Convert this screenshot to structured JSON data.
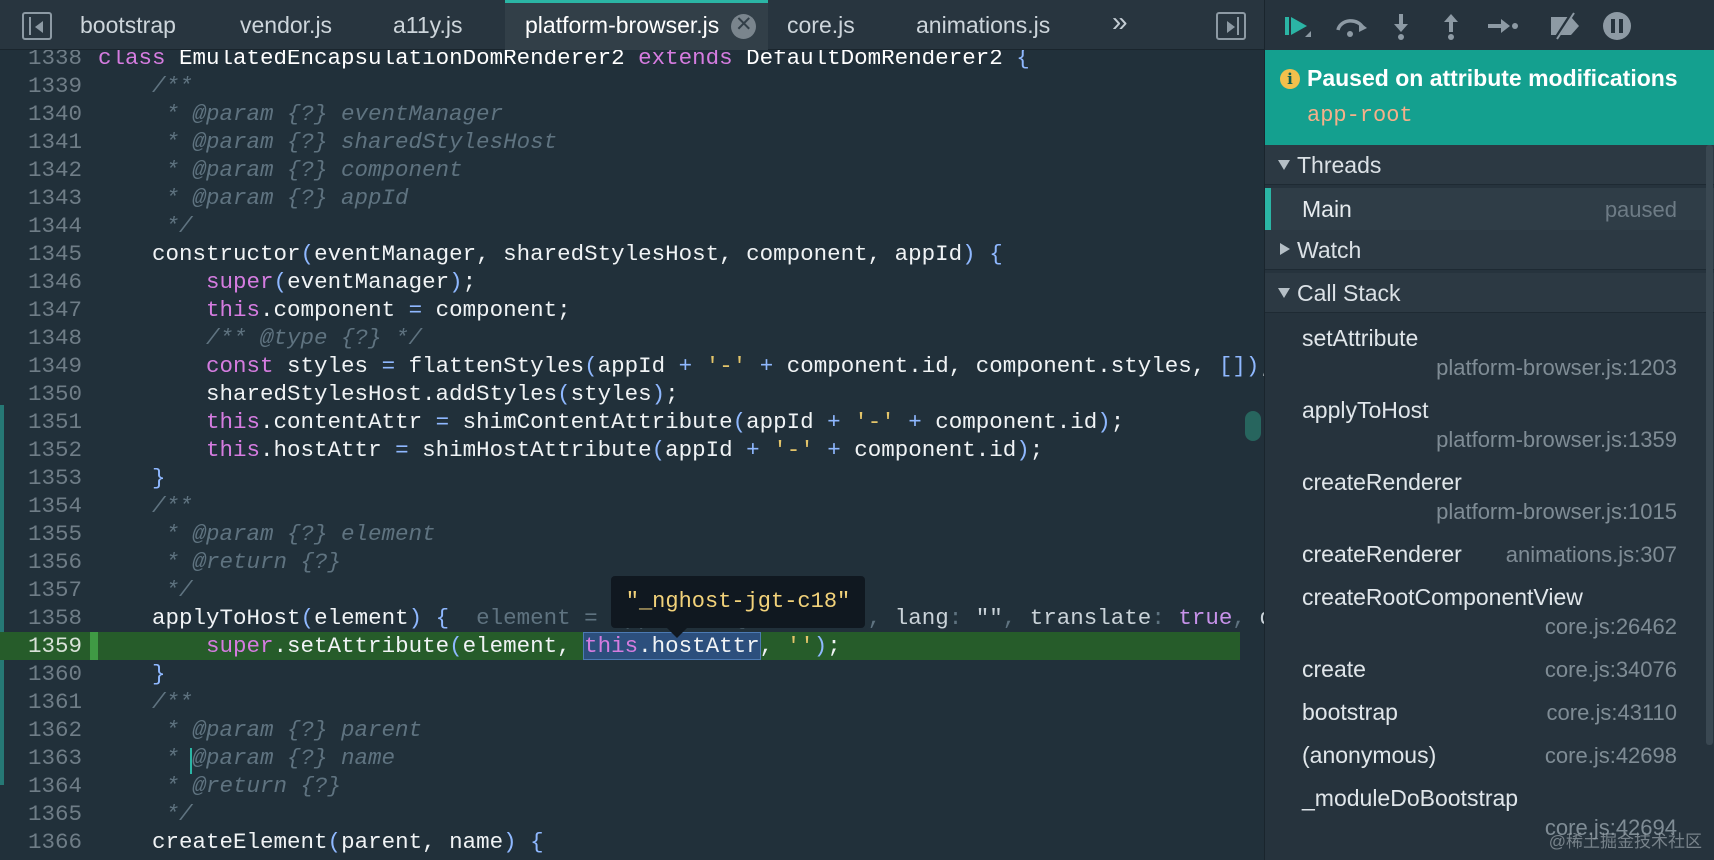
{
  "tabs": [
    {
      "label": "bootstrap"
    },
    {
      "label": "vendor.js"
    },
    {
      "label": "a11y.js"
    },
    {
      "label": "platform-browser.js",
      "active": true
    },
    {
      "label": "core.js"
    },
    {
      "label": "animations.js"
    }
  ],
  "tabs_more": "»",
  "tab_close": "✕",
  "editor": {
    "line_numbers": [
      "1338",
      "1339",
      "1340",
      "1341",
      "1342",
      "1343",
      "1344",
      "1345",
      "1346",
      "1347",
      "1348",
      "1349",
      "1350",
      "1351",
      "1352",
      "1353",
      "1354",
      "1355",
      "1356",
      "1357",
      "1358",
      "1359",
      "1360",
      "1361",
      "1362",
      "1363",
      "1364",
      "1365",
      "1366"
    ],
    "current_line": "1359",
    "tooltip": "\"_nghost-jgt-c18\""
  },
  "debugger": {
    "paused_title": "Paused on attribute modifications",
    "paused_target": "app-root",
    "info_icon": "i",
    "sections": {
      "threads": "Threads",
      "watch": "Watch",
      "call_stack": "Call Stack"
    },
    "thread": {
      "name": "Main",
      "state": "paused"
    },
    "call_stack": [
      {
        "fn": "setAttribute",
        "loc": "platform-browser.js:1203"
      },
      {
        "fn": "applyToHost",
        "loc": "platform-browser.js:1359"
      },
      {
        "fn": "createRenderer",
        "loc": "platform-browser.js:1015"
      },
      {
        "fn": "createRenderer",
        "loc": "animations.js:307"
      },
      {
        "fn": "createRootComponentView",
        "loc": "core.js:26462"
      },
      {
        "fn": "create",
        "loc": "core.js:34076"
      },
      {
        "fn": "bootstrap",
        "loc": "core.js:43110"
      },
      {
        "fn": "(anonymous)",
        "loc": "core.js:42698"
      },
      {
        "fn": "_moduleDoBootstrap",
        "loc": "core.js:42694"
      }
    ],
    "toolbar_icons": [
      "resume-icon",
      "step-over-icon",
      "step-into-icon",
      "step-out-icon",
      "step-icon",
      "deactivate-breakpoints-icon",
      "pause-on-exceptions-icon"
    ],
    "accent_color": "#14a08f"
  },
  "watermark": "@稀土掘金技术社区"
}
